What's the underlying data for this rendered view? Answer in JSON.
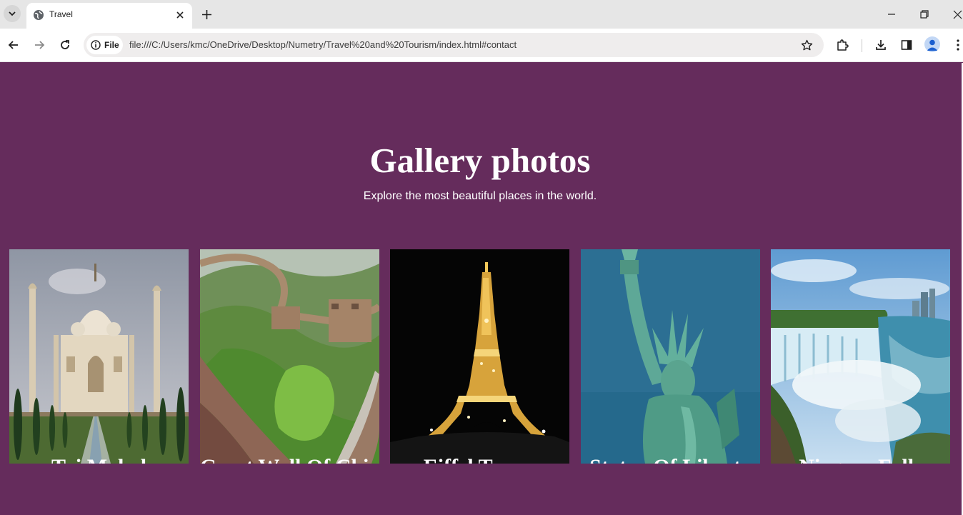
{
  "browser": {
    "tab_title": "Travel",
    "site_chip_label": "File",
    "url": "file:///C:/Users/kmc/OneDrive/Desktop/Numetry/Travel%20and%20Tourism/index.html#contact"
  },
  "page": {
    "heading": "Gallery photos",
    "subheading": "Explore the most beautiful places in the world.",
    "gallery": [
      {
        "caption": "Taj Mahal"
      },
      {
        "caption": "Great Wall Of China"
      },
      {
        "caption": "Eiffel Tower"
      },
      {
        "caption": "Statue Of Liberty"
      },
      {
        "caption": "Niagara Falls"
      }
    ]
  },
  "colors": {
    "page_background": "#652c5c",
    "heading_text": "#ffffff"
  }
}
